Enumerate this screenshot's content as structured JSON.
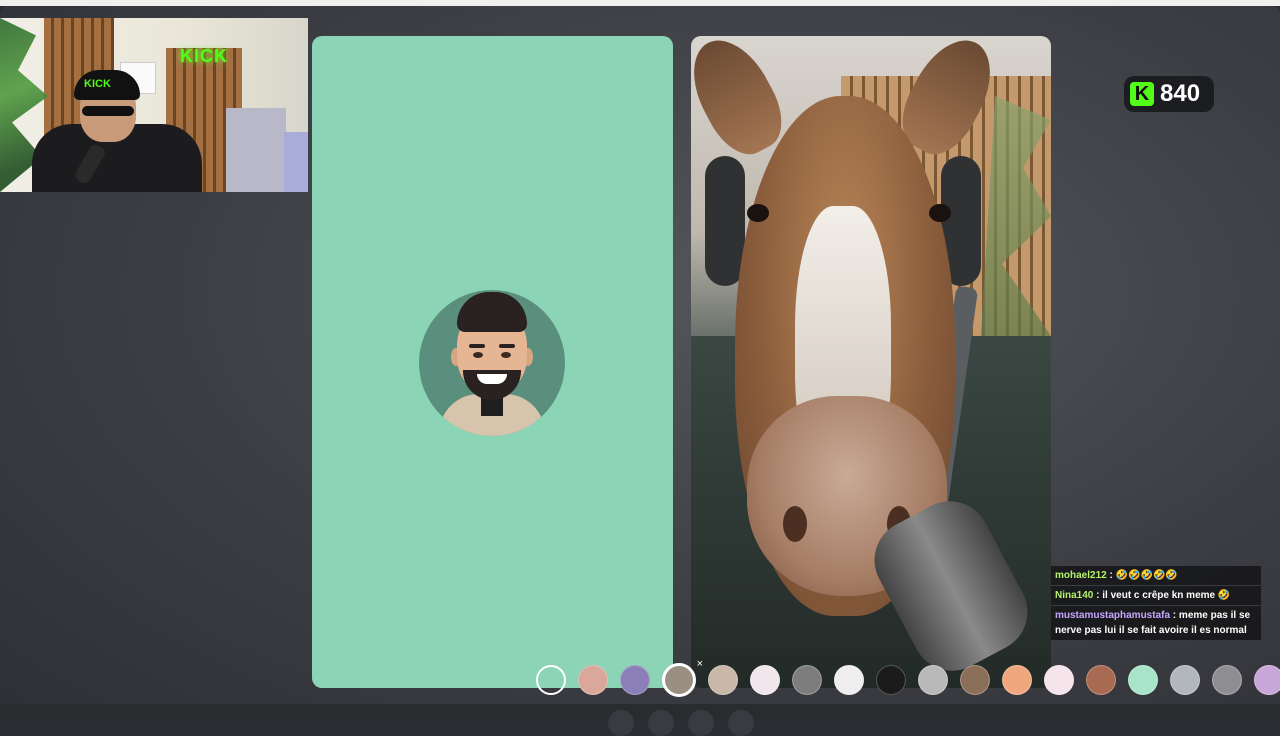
{
  "webcam": {
    "sign_text": "KICK",
    "cap_text": "KICK"
  },
  "follower_badge": {
    "icon": "kick-k-icon",
    "logo_letter": "K",
    "count": "840",
    "accent_color": "#53fc18"
  },
  "chat": {
    "messages": [
      {
        "user": "mohael212",
        "sep": " : ",
        "text": "🤣🤣🤣🤣🤣"
      },
      {
        "user": "Nina140",
        "sep": " : ",
        "text": "il veut c crêpe kn meme 🤣"
      },
      {
        "user": "mustamustaphamustafa",
        "sep": " : ",
        "text": "meme pas il se nerve pas lui il se fait avoire il es normal"
      }
    ]
  },
  "filters": {
    "items": [
      {
        "name": "none",
        "color": "transparent"
      },
      {
        "name": "skin",
        "color": "#d9a89b"
      },
      {
        "name": "purple",
        "color": "#8a7fb8"
      },
      {
        "name": "donkey",
        "color": "#9a8f82",
        "selected": true,
        "close": "×"
      },
      {
        "name": "dog",
        "color": "#c9b7a8"
      },
      {
        "name": "pink-face",
        "color": "#f1e6ec"
      },
      {
        "name": "gray-face",
        "color": "#7d7d7d"
      },
      {
        "name": "panda",
        "color": "#eeeeee"
      },
      {
        "name": "devil",
        "color": "#1b1b1b"
      },
      {
        "name": "sad",
        "color": "#b9b9b9"
      },
      {
        "name": "monkey",
        "color": "#8b6f59"
      },
      {
        "name": "orange",
        "color": "#f1a77e"
      },
      {
        "name": "pink-bunny",
        "color": "#f5e4ea"
      },
      {
        "name": "man",
        "color": "#a86a52"
      },
      {
        "name": "alien",
        "color": "#a8e4c8"
      },
      {
        "name": "robot",
        "color": "#b2b7bd"
      },
      {
        "name": "gray",
        "color": "#8e8e92"
      },
      {
        "name": "stars",
        "color": "#c8a6d8"
      }
    ]
  }
}
